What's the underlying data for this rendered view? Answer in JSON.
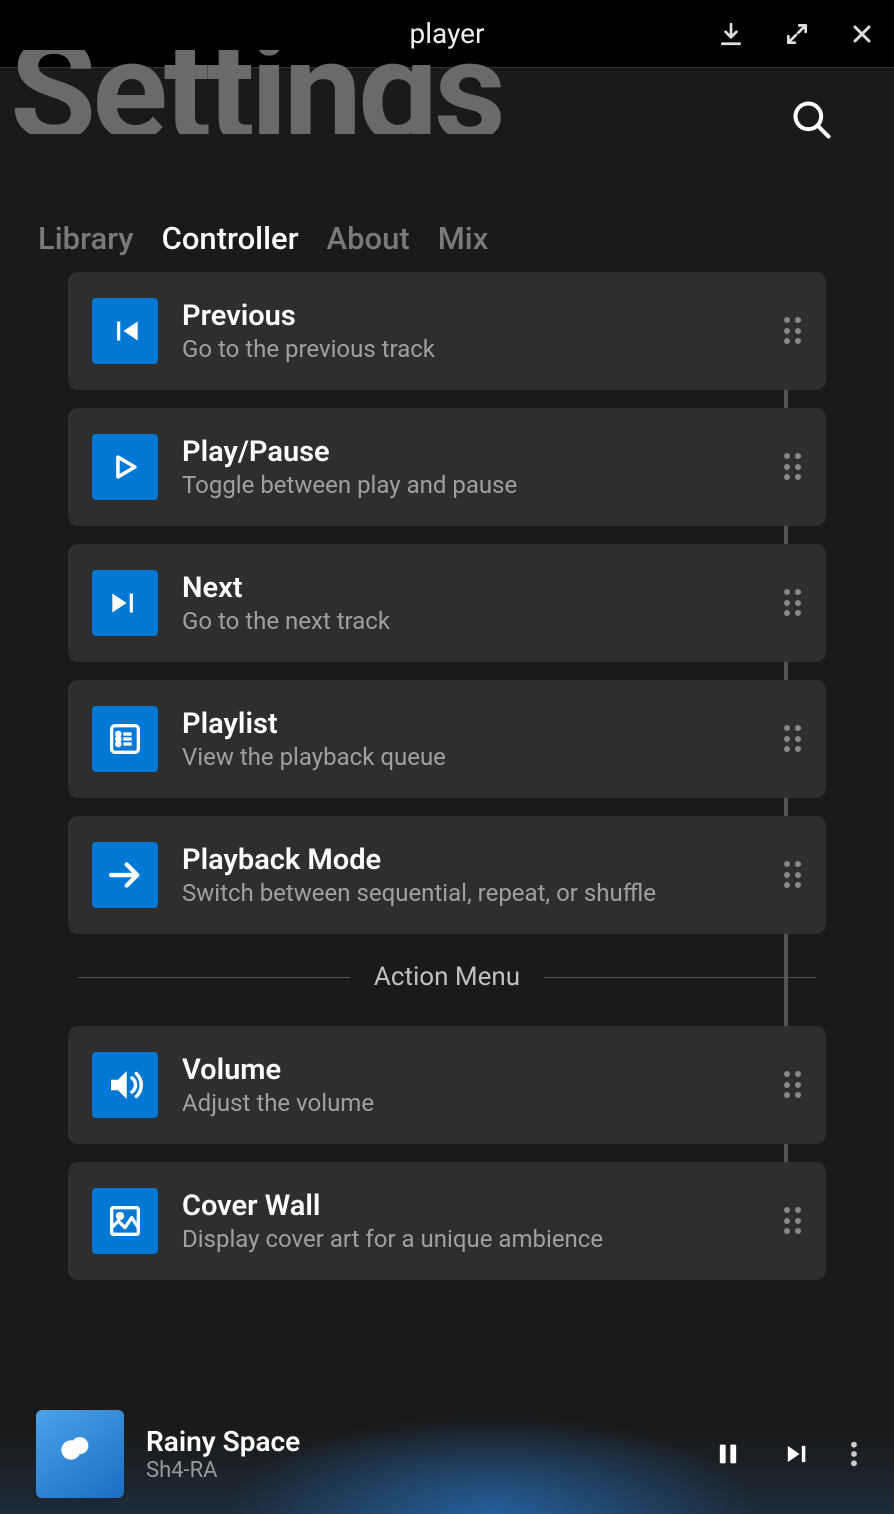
{
  "window": {
    "title": "player"
  },
  "header": {
    "title": "Settings"
  },
  "tabs": {
    "library": "Library",
    "controller": "Controller",
    "about": "About",
    "mix": "Mix",
    "active": "controller"
  },
  "controller_items": [
    {
      "icon": "skip-previous",
      "title": "Previous",
      "desc": "Go to the previous track"
    },
    {
      "icon": "play",
      "title": "Play/Pause",
      "desc": "Toggle between play and pause"
    },
    {
      "icon": "skip-next",
      "title": "Next",
      "desc": "Go to the next track"
    },
    {
      "icon": "playlist",
      "title": "Playlist",
      "desc": "View the playback queue"
    },
    {
      "icon": "arrow-right",
      "title": "Playback Mode",
      "desc": "Switch between sequential, repeat, or shuffle"
    }
  ],
  "section": {
    "action_menu": "Action Menu"
  },
  "action_items": [
    {
      "icon": "volume",
      "title": "Volume",
      "desc": "Adjust the volume"
    },
    {
      "icon": "image",
      "title": "Cover Wall",
      "desc": "Display cover art for a unique ambience"
    }
  ],
  "now_playing": {
    "title": "Rainy Space",
    "artist": "Sh4-RA"
  },
  "colors": {
    "accent": "#0078d4"
  }
}
